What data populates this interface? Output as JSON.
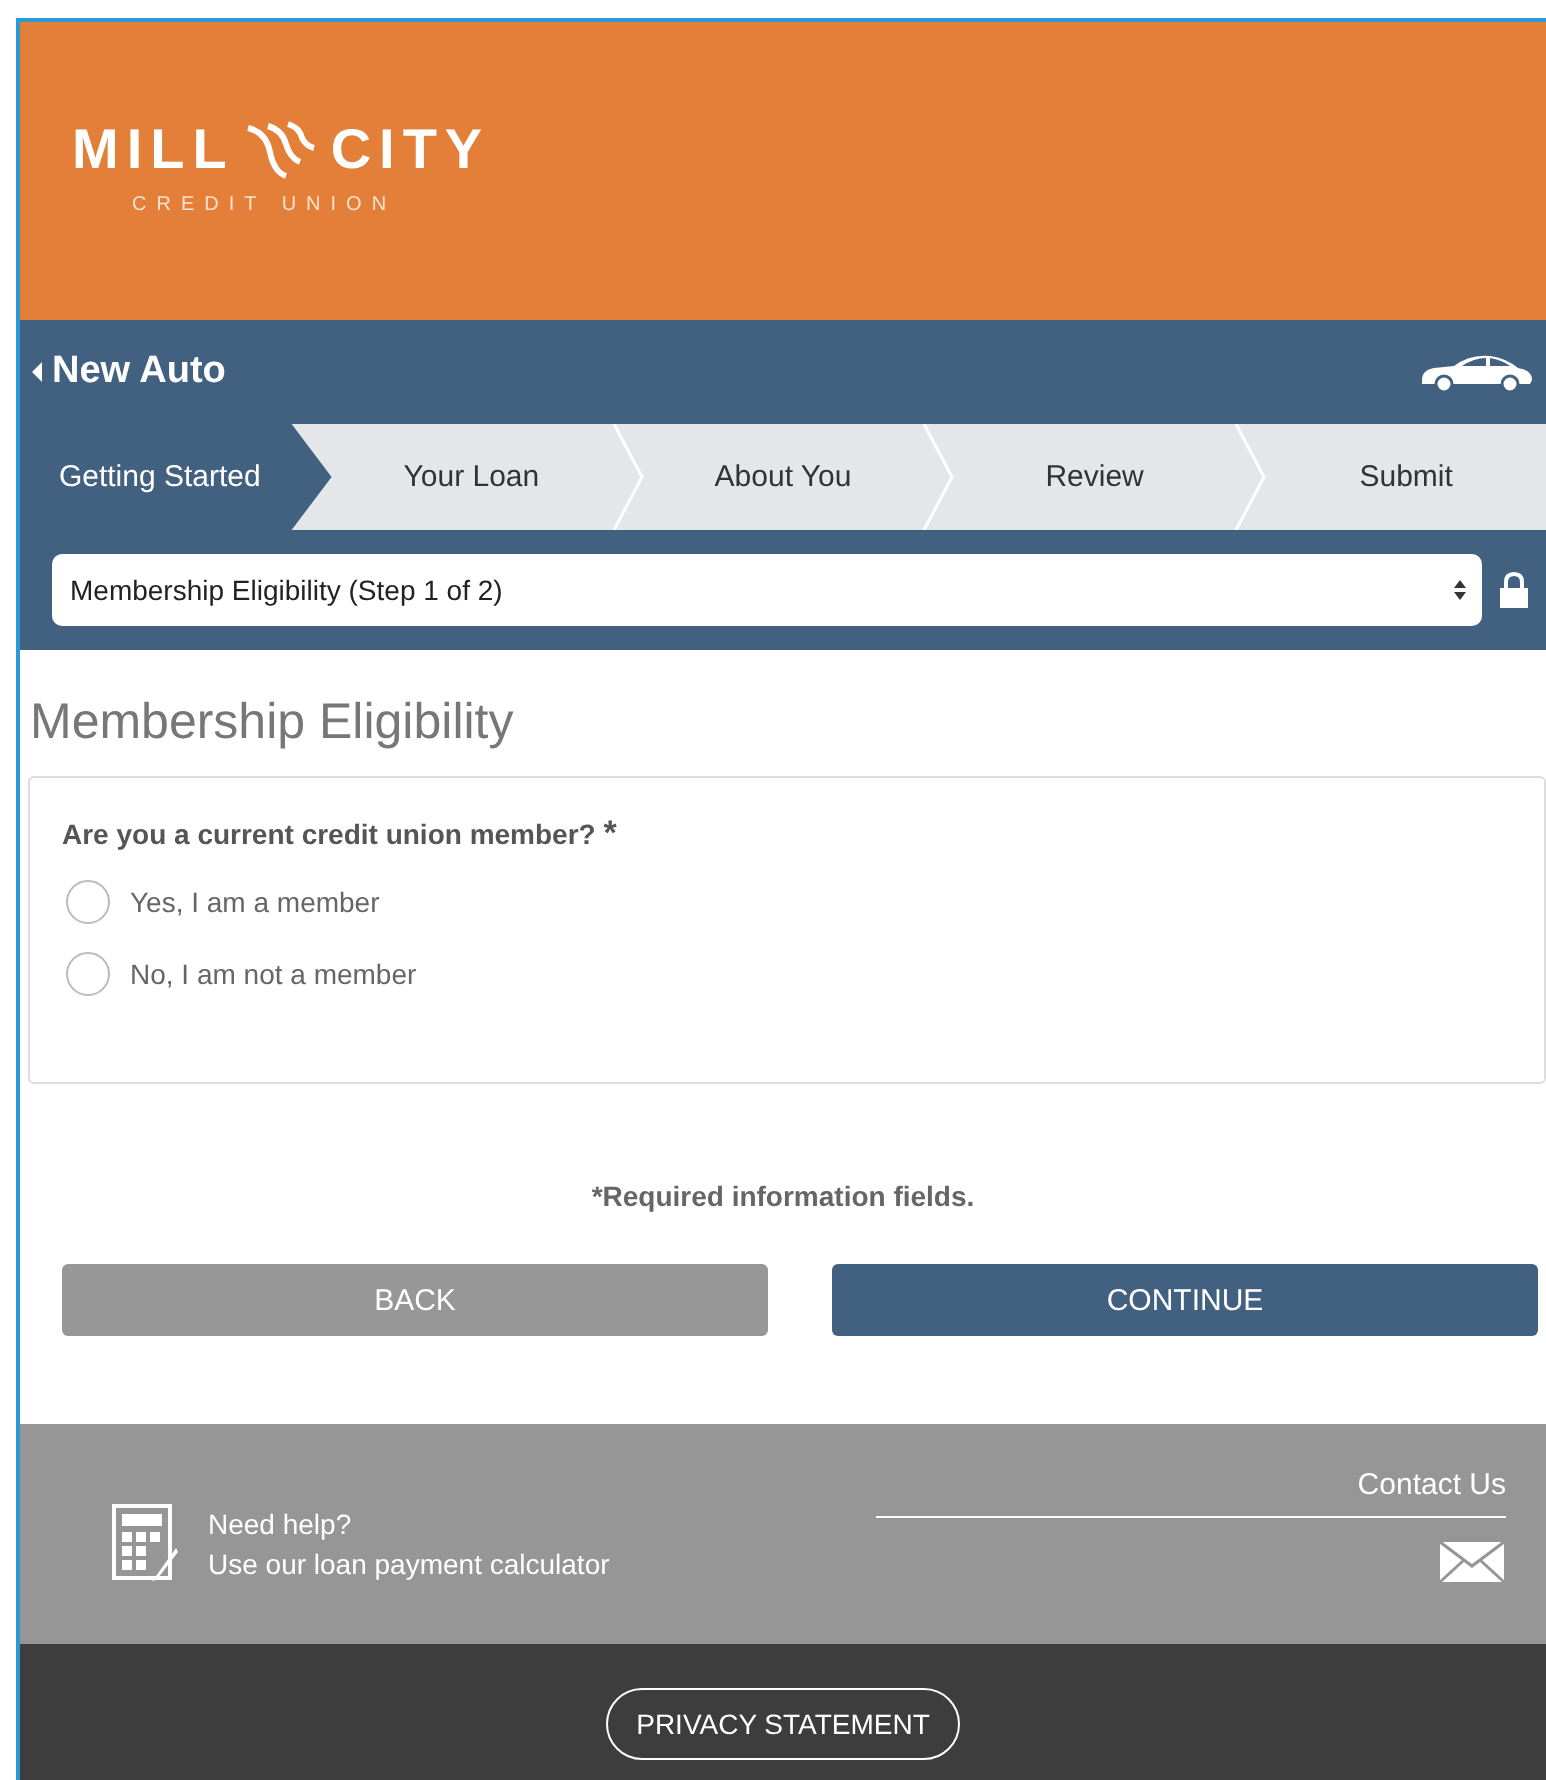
{
  "header": {
    "logo": {
      "word_left": "MILL",
      "word_right": "CITY",
      "tagline": "CREDIT UNION"
    }
  },
  "nav": {
    "back_label": "New Auto"
  },
  "steps": [
    {
      "label": "Getting Started",
      "selected": true
    },
    {
      "label": "Your Loan",
      "selected": false
    },
    {
      "label": "About You",
      "selected": false
    },
    {
      "label": "Review",
      "selected": false
    },
    {
      "label": "Submit",
      "selected": false
    }
  ],
  "step_select": {
    "value": "Membership Eligibility (Step 1 of 2)"
  },
  "page_title": "Membership Eligibility",
  "question": {
    "label": "Are you a current credit union member?",
    "required_mark": "*",
    "options": [
      {
        "label": "Yes, I am a member",
        "selected": false
      },
      {
        "label": "No, I am not a member",
        "selected": false
      }
    ]
  },
  "required_note": "*Required information fields.",
  "buttons": [
    {
      "label": "BACK",
      "kind": "secondary"
    },
    {
      "label": "CONTINUE",
      "kind": "primary"
    }
  ],
  "footer": {
    "help_title": "Need help?",
    "help_link": "Use our loan payment calculator",
    "contact": "Contact Us",
    "privacy": "PRIVACY STATEMENT"
  }
}
